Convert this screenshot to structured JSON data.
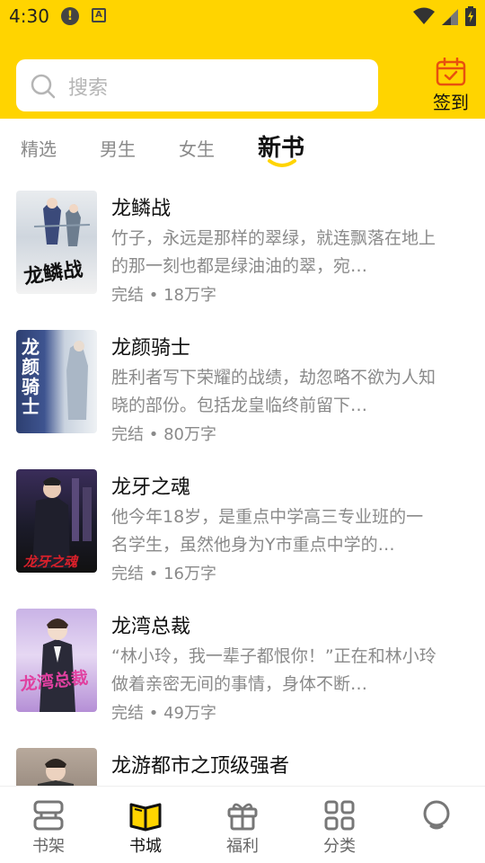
{
  "status_bar": {
    "time": "4:30",
    "icons": [
      "alert-icon",
      "a-notification-icon",
      "wifi-icon",
      "signal-icon",
      "battery-icon"
    ]
  },
  "header": {
    "search": {
      "placeholder": "搜索"
    },
    "signin": {
      "label": "签到",
      "icon": "calendar-check-icon"
    }
  },
  "tabs": [
    {
      "label": "精选",
      "active": false
    },
    {
      "label": "男生",
      "active": false
    },
    {
      "label": "女生",
      "active": false
    },
    {
      "label": "新书",
      "active": true
    }
  ],
  "books": [
    {
      "title": "龙鳞战",
      "description": "竹子，永远是那样的翠绿，就连飘落在地上的那一刻也都是绿油油的翠，宛…",
      "status": "完结",
      "word_count": "18万字",
      "cover_text": "龙鳞战"
    },
    {
      "title": "龙颜骑士",
      "description": "胜利者写下荣耀的战绩，劫忽略不欲为人知晓的部份。包括龙皇临终前留下…",
      "status": "完结",
      "word_count": "80万字",
      "cover_text": "龙颜骑士"
    },
    {
      "title": "龙牙之魂",
      "description": "他今年18岁，是重点中学高三专业班的一名学生，虽然他身为Y市重点中学的…",
      "status": "完结",
      "word_count": "16万字",
      "cover_text": "龙牙之魂"
    },
    {
      "title": "龙湾总裁",
      "description": "“林小玲，我一辈子都恨你！”正在和林小玲做着亲密无间的事情，身体不断…",
      "status": "完结",
      "word_count": "49万字",
      "cover_text": "龙湾总裁"
    },
    {
      "title": "龙游都市之顶级强者",
      "description": "",
      "status": "",
      "word_count": "",
      "cover_text": ""
    }
  ],
  "bottom_nav": [
    {
      "label": "书架",
      "icon": "bookshelf-icon",
      "active": false
    },
    {
      "label": "书城",
      "icon": "bookstore-icon",
      "active": true
    },
    {
      "label": "福利",
      "icon": "gift-icon",
      "active": false
    },
    {
      "label": "分类",
      "icon": "category-grid-icon",
      "active": false
    },
    {
      "label": "",
      "icon": "profile-icon",
      "active": false
    }
  ],
  "colors": {
    "brand_yellow": "#FFD400",
    "text_primary": "#111111",
    "text_secondary": "#8A8A8A"
  }
}
